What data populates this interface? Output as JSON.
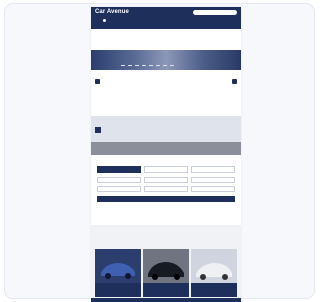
{
  "header": {
    "logo": "Car Avenue",
    "links": [
      "",
      "",
      "",
      ""
    ],
    "phone": ""
  },
  "crumbs": [
    "",
    "",
    "",
    "",
    "",
    "",
    "",
    ""
  ],
  "promo": {
    "title": "",
    "subtitle": "",
    "button": ""
  },
  "form": {
    "title": "",
    "tabs": [
      "",
      "",
      ""
    ],
    "fields": [
      "",
      "",
      "",
      "",
      "",
      ""
    ],
    "submit": ""
  },
  "reco": {
    "title": "",
    "cars": [
      {
        "name": "",
        "sub": ""
      },
      {
        "name": "",
        "sub": ""
      },
      {
        "name": "",
        "sub": ""
      }
    ]
  },
  "colors": {
    "brand": "#1f2f5c",
    "background": "#f6f8fc"
  }
}
